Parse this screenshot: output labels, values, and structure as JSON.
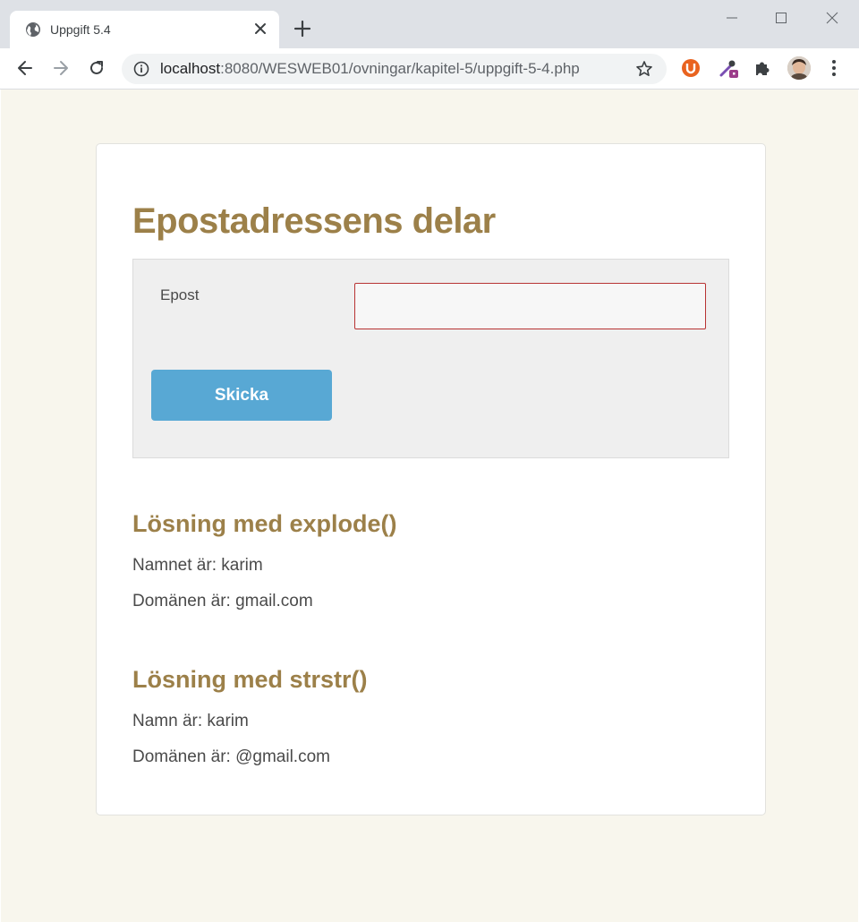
{
  "browser": {
    "tab_title": "Uppgift 5.4",
    "url_host": "localhost",
    "url_path": ":8080/WESWEB01/ovningar/kapitel-5/uppgift-5-4.php"
  },
  "page": {
    "heading": "Epostadressens delar",
    "form": {
      "email_label": "Epost",
      "email_value": "",
      "submit_label": "Skicka"
    },
    "explode_section": {
      "heading": "Lösning med explode()",
      "name_line": "Namnet är: karim",
      "domain_line": "Domänen är: gmail.com"
    },
    "strstr_section": {
      "heading": "Lösning med strstr()",
      "name_line": "Namn är: karim",
      "domain_line": "Domänen är: @gmail.com"
    }
  },
  "colors": {
    "heading": "#9c8049",
    "page_background": "#f8f6ed",
    "button": "#58a8d4",
    "input_border": "#b83333"
  },
  "icons": [
    "globe-icon",
    "close-icon",
    "plus-icon",
    "minimize-icon",
    "maximize-icon",
    "window-close-icon",
    "back-arrow-icon",
    "forward-arrow-icon",
    "reload-icon",
    "info-icon",
    "star-icon",
    "ublock-extension-icon",
    "color-picker-extension-icon",
    "puzzle-icon",
    "avatar",
    "more-vert-icon"
  ]
}
